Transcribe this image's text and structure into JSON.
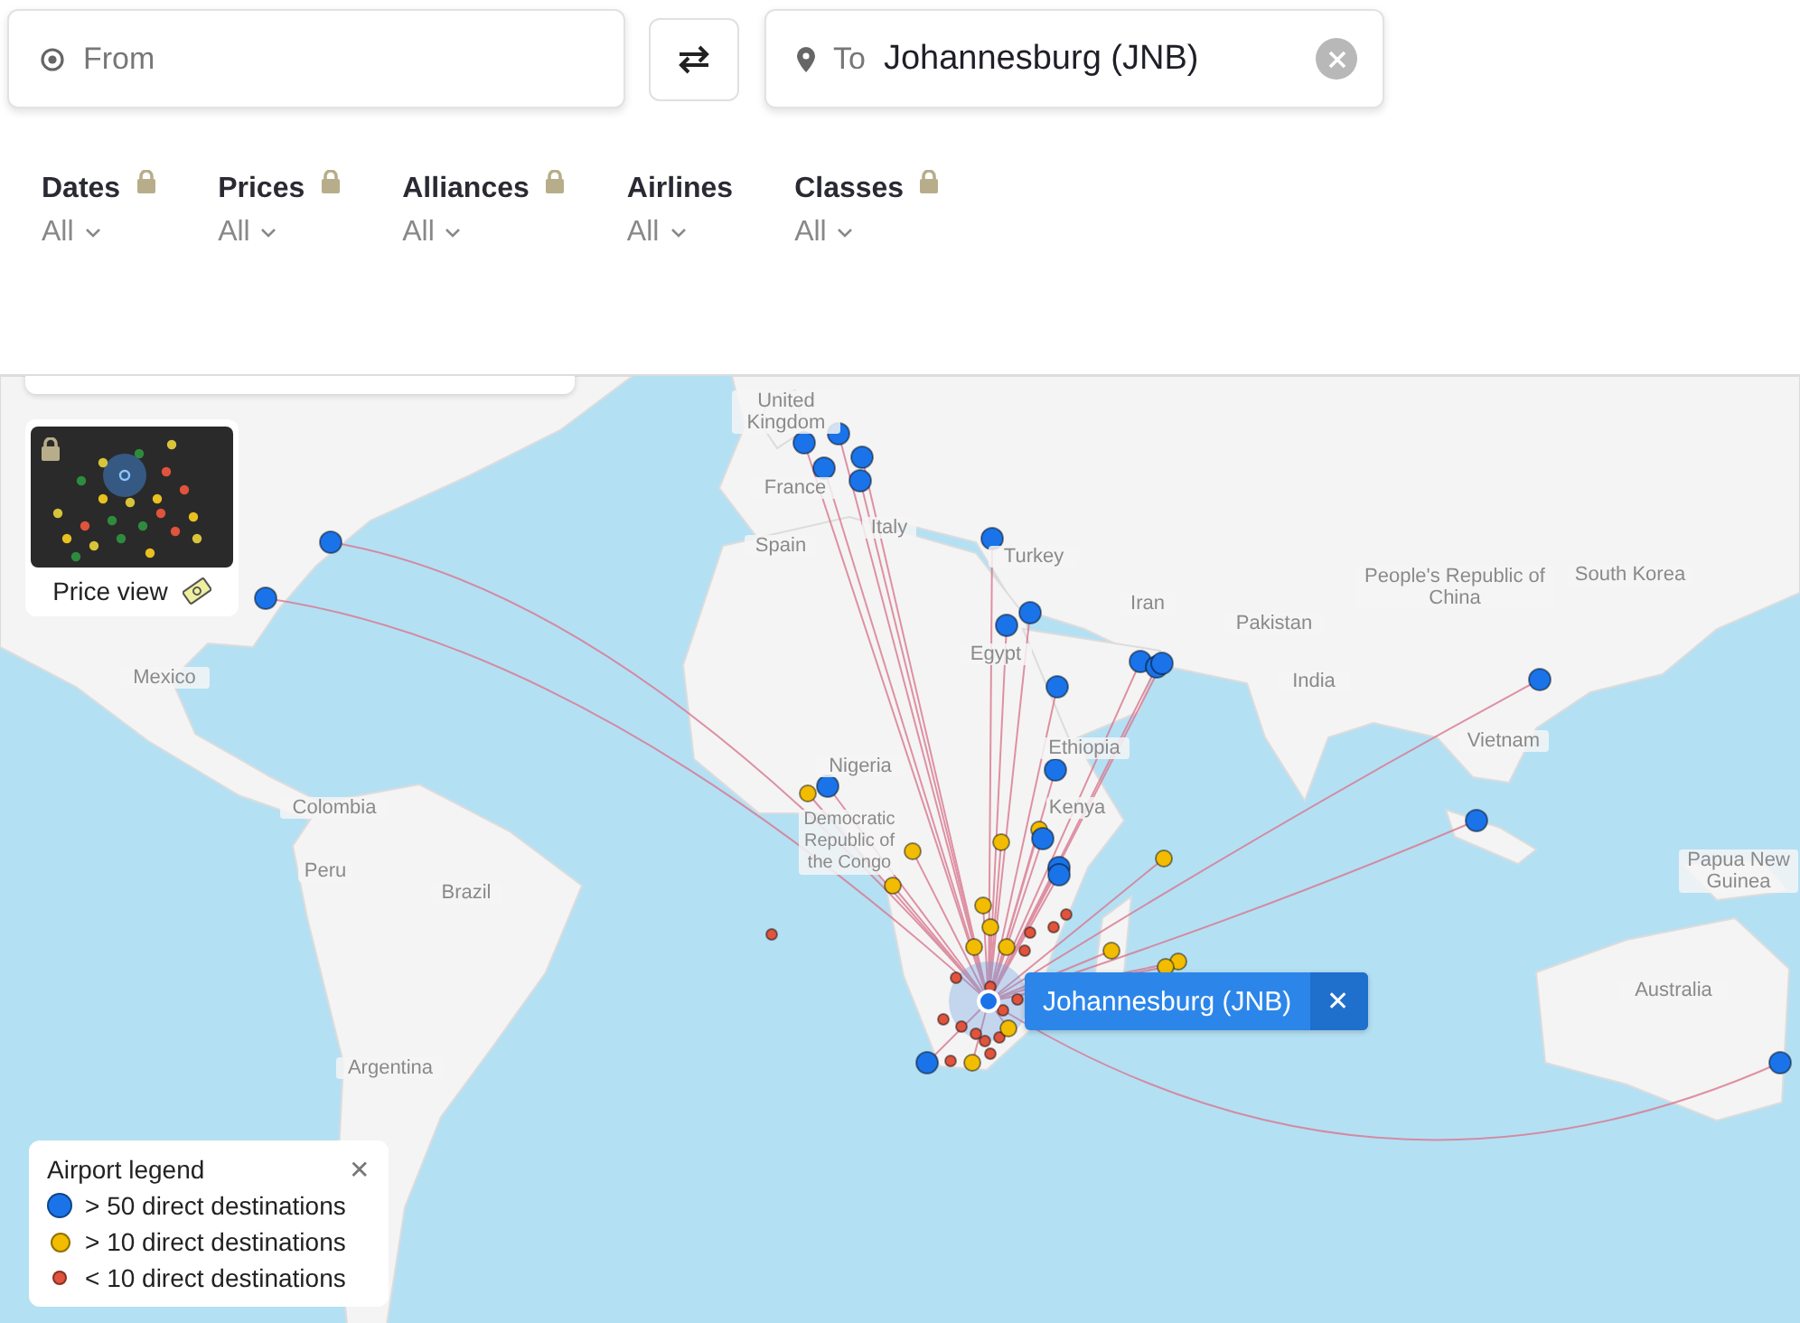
{
  "search": {
    "from": {
      "placeholder": "From"
    },
    "to": {
      "label": "To",
      "value": "Johannesburg (JNB)"
    }
  },
  "filters": [
    {
      "label": "Dates",
      "value": "All",
      "locked": true
    },
    {
      "label": "Prices",
      "value": "All",
      "locked": true
    },
    {
      "label": "Alliances",
      "value": "All",
      "locked": true
    },
    {
      "label": "Airlines",
      "value": "All",
      "locked": false
    },
    {
      "label": "Classes",
      "value": "All",
      "locked": true
    }
  ],
  "map": {
    "labels": [
      "United Kingdom",
      "France",
      "Italy",
      "Spain",
      "Turkey",
      "Iran",
      "Egypt",
      "Pakistan",
      "India",
      "People's Republic of China",
      "South Korea",
      "Vietnam",
      "Mexico",
      "Colombia",
      "Peru",
      "Brazil",
      "Argentina",
      "Nigeria",
      "Ethiopia",
      "Kenya",
      "Democratic Republic of the Congo",
      "Australia",
      "Papua New Guinea"
    ],
    "price_view": {
      "label": "Price view",
      "locked": true
    },
    "selected_airport": {
      "label": "Johannesburg (JNB)",
      "close": "✕"
    },
    "legend": {
      "title": "Airport legend",
      "close": "✕",
      "items": [
        {
          "label": "> 50 direct destinations",
          "kind": "large",
          "color": "#1a73e8"
        },
        {
          "label": "> 10 direct destinations",
          "kind": "medium",
          "color": "#f2bd00"
        },
        {
          "label": "< 10 direct destinations",
          "kind": "small",
          "color": "#e0533c"
        }
      ]
    }
  }
}
